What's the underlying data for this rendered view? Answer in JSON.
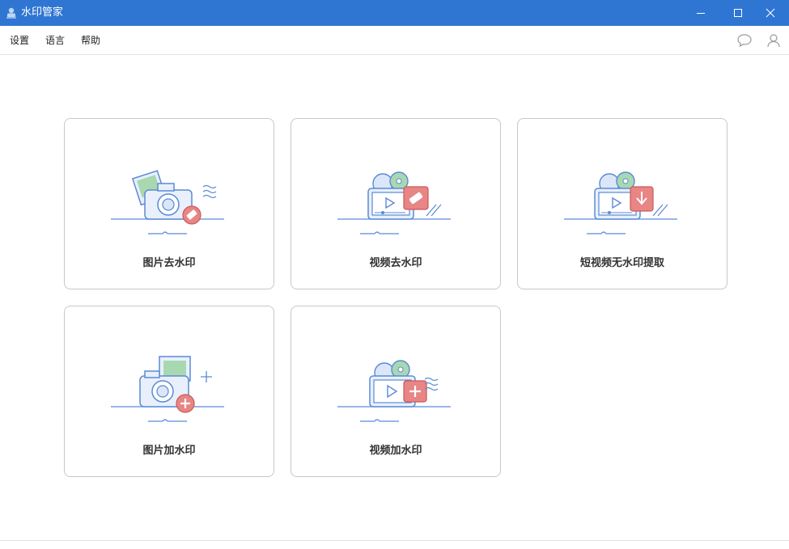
{
  "window": {
    "title": "水印管家",
    "accent_color": "#2f76d2"
  },
  "menu": {
    "settings": "设置",
    "language": "语言",
    "help": "帮助"
  },
  "toolbar_icons": [
    "chat-bubble-icon",
    "user-icon"
  ],
  "cards": [
    {
      "label": "图片去水印",
      "icon": "photo-eraser-icon"
    },
    {
      "label": "视频去水印",
      "icon": "video-eraser-icon"
    },
    {
      "label": "短视频无水印提取",
      "icon": "video-download-icon"
    },
    {
      "label": "图片加水印",
      "icon": "photo-add-icon"
    },
    {
      "label": "视频加水印",
      "icon": "video-add-icon"
    }
  ]
}
